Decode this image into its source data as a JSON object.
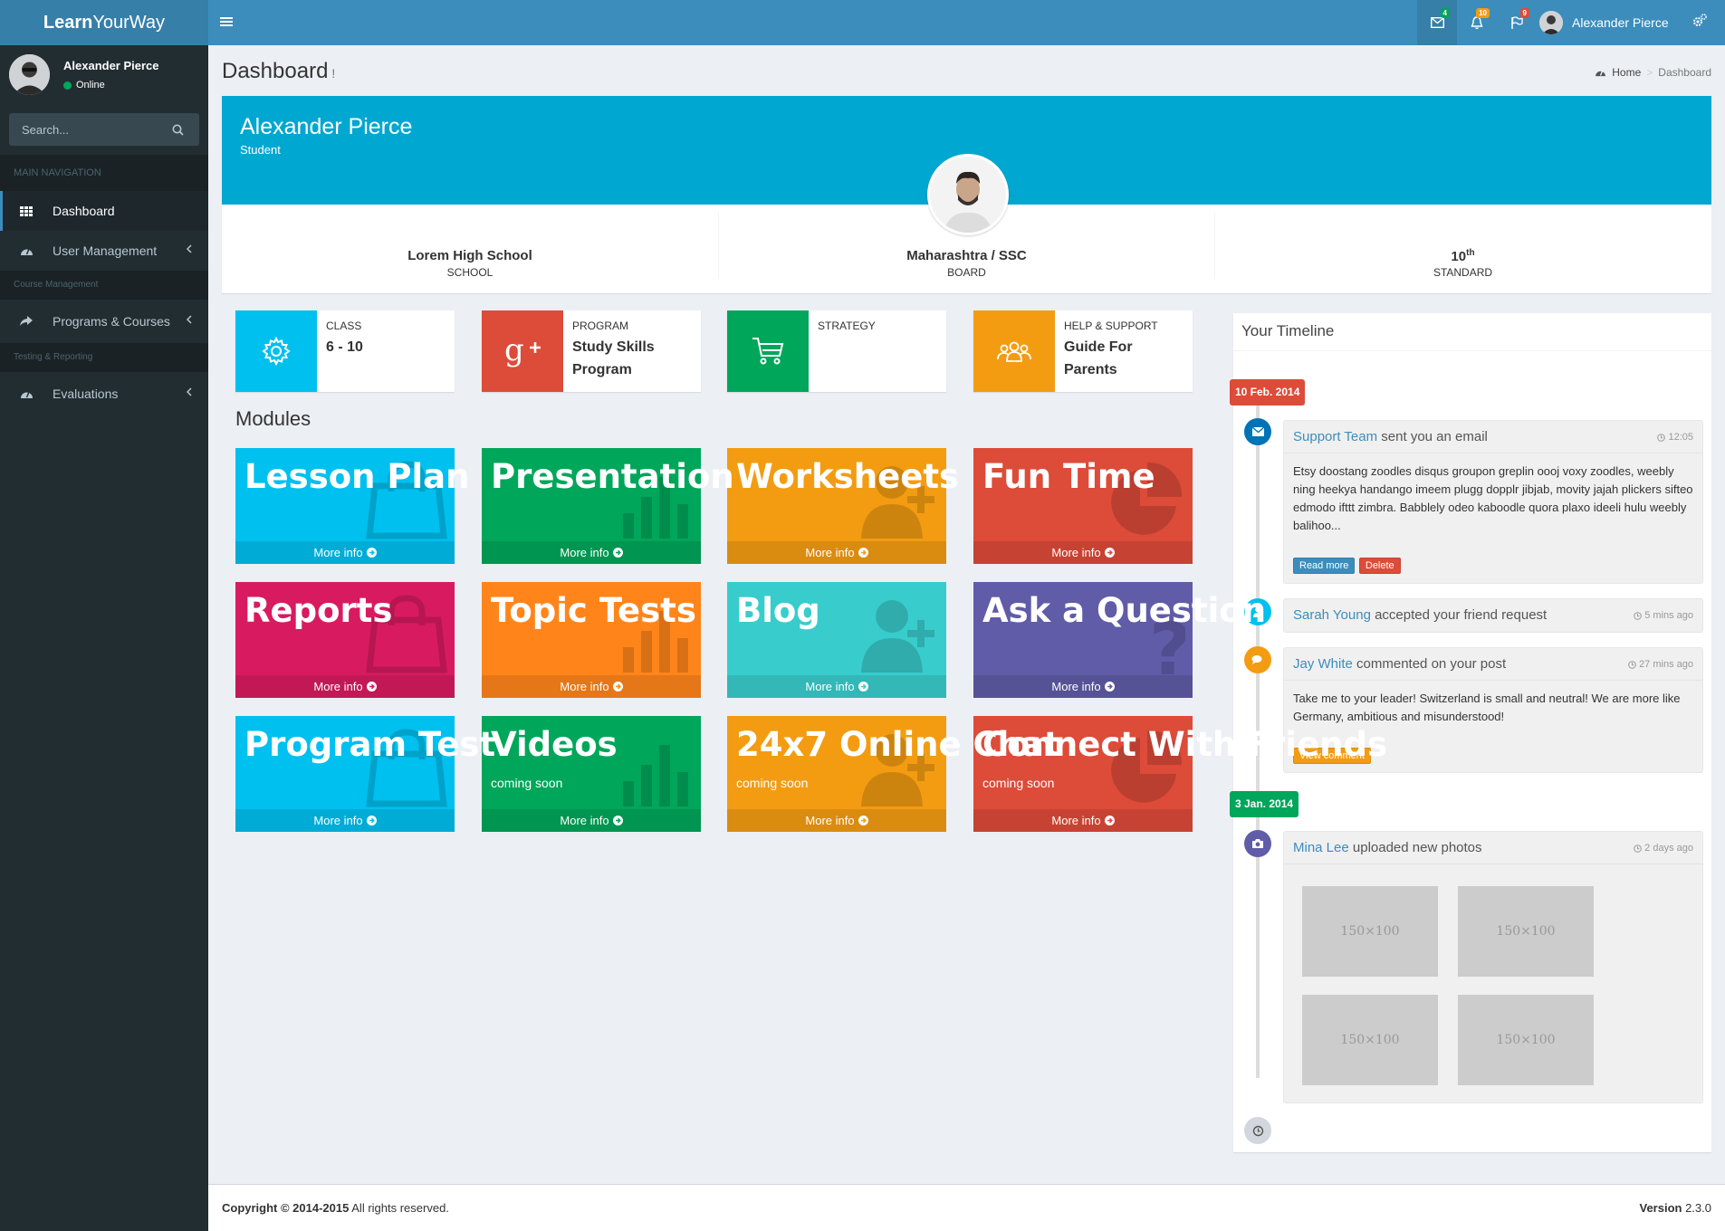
{
  "app": {
    "logo_bold": "Learn",
    "logo_rest": "YourWay"
  },
  "header": {
    "mail_count": "4",
    "notif_count": "10",
    "flag_count": "9",
    "user_name": "Alexander Pierce"
  },
  "sidebar": {
    "user_name": "Alexander Pierce",
    "status": "Online",
    "search_placeholder": "Search...",
    "sections": [
      {
        "header": "MAIN NAVIGATION"
      },
      {
        "header": "Course Management"
      },
      {
        "header": "Testing & Reporting"
      }
    ],
    "items": [
      {
        "label": "Dashboard",
        "icon": "grid-icon"
      },
      {
        "label": "User Management",
        "icon": "dashboard-icon"
      },
      {
        "label": "Programs & Courses",
        "icon": "share-icon"
      },
      {
        "label": "Evaluations",
        "icon": "dashboard-icon"
      }
    ]
  },
  "page": {
    "title": "Dashboard",
    "subtitle": "!",
    "breadcrumb_home": "Home",
    "breadcrumb_current": "Dashboard"
  },
  "profile": {
    "name": "Alexander Pierce",
    "role": "Student",
    "stats": [
      {
        "value": "Lorem High School",
        "label": "SCHOOL"
      },
      {
        "value": "Maharashtra / SSC",
        "label": "BOARD"
      },
      {
        "value": "10",
        "sup": "th",
        "label": "STANDARD"
      }
    ]
  },
  "info_boxes": [
    {
      "label": "CLASS",
      "value": "6 - 10",
      "color": "#00c0ef",
      "icon": "gear-icon"
    },
    {
      "label": "PROGRAM",
      "value": "Study Skills Program",
      "color": "#dd4b39",
      "icon": "google-plus-icon"
    },
    {
      "label": "STRATEGY",
      "value": "",
      "color": "#00a65a",
      "icon": "cart-icon"
    },
    {
      "label": "HELP & SUPPORT",
      "value": "Guide For Parents",
      "color": "#f39c12",
      "icon": "users-icon"
    }
  ],
  "modules": {
    "title": "Modules",
    "more_info": "More info",
    "tiles": [
      {
        "title": "Lesson Plan",
        "sub": "",
        "color": "#00c0ef",
        "icon": "bag-icon"
      },
      {
        "title": "Presentation",
        "sub": "",
        "color": "#00a65a",
        "icon": "bar-chart-icon"
      },
      {
        "title": "Worksheets",
        "sub": "",
        "color": "#f39c12",
        "icon": "user-add-icon"
      },
      {
        "title": "Fun Time",
        "sub": "",
        "color": "#dd4b39",
        "icon": "pie-chart-icon"
      },
      {
        "title": "Reports",
        "sub": "",
        "color": "#d81b60",
        "icon": "bag-icon"
      },
      {
        "title": "Topic Tests",
        "sub": "",
        "color": "#ff851b",
        "icon": "bar-chart-icon"
      },
      {
        "title": "Blog",
        "sub": "",
        "color": "#39cccc",
        "icon": "user-add-icon"
      },
      {
        "title": "Ask a Question",
        "sub": "",
        "color": "#605ca8",
        "icon": "question-icon"
      },
      {
        "title": "Program Test",
        "sub": "",
        "color": "#00c0ef",
        "icon": "bag-icon"
      },
      {
        "title": "Videos",
        "sub": "coming soon",
        "color": "#00a65a",
        "icon": "bar-chart-icon"
      },
      {
        "title": "24x7 Online Chat",
        "sub": "coming soon",
        "color": "#f39c12",
        "icon": "user-add-icon"
      },
      {
        "title": "Connect With Friends",
        "sub": "coming soon",
        "color": "#dd4b39",
        "icon": "pie-chart-icon"
      }
    ]
  },
  "timeline": {
    "title": "Your Timeline",
    "labels": [
      {
        "text": "10 Feb. 2014",
        "color": "#dd4b39"
      },
      {
        "text": "3 Jan. 2014",
        "color": "#00a65a"
      }
    ],
    "items": [
      {
        "who": "Support Team",
        "what": "sent you an email",
        "time": "12:05",
        "body": "Etsy doostang zoodles disqus groupon greplin oooj voxy zoodles, weebly ning heekya handango imeem plugg dopplr jibjab, movity jajah plickers sifteo edmodo ifttt zimbra. Babblely odeo kaboodle quora plaxo ideeli hulu weebly balihoo...",
        "btn1": "Read more",
        "btn2": "Delete"
      },
      {
        "who": "Sarah Young",
        "what": "accepted your friend request",
        "time": "5 mins ago"
      },
      {
        "who": "Jay White",
        "what": "commented on your post",
        "time": "27 mins ago",
        "body": "Take me to your leader! Switzerland is small and neutral! We are more like Germany, ambitious and misunderstood!",
        "btn1": "View comment"
      },
      {
        "who": "Mina Lee",
        "what": "uploaded new photos",
        "time": "2 days ago",
        "placeholder": "150×100"
      }
    ]
  },
  "footer": {
    "copyright": "Copyright © 2014-2015",
    "rights": "All rights reserved.",
    "version_label": "Version",
    "version": "2.3.0"
  }
}
